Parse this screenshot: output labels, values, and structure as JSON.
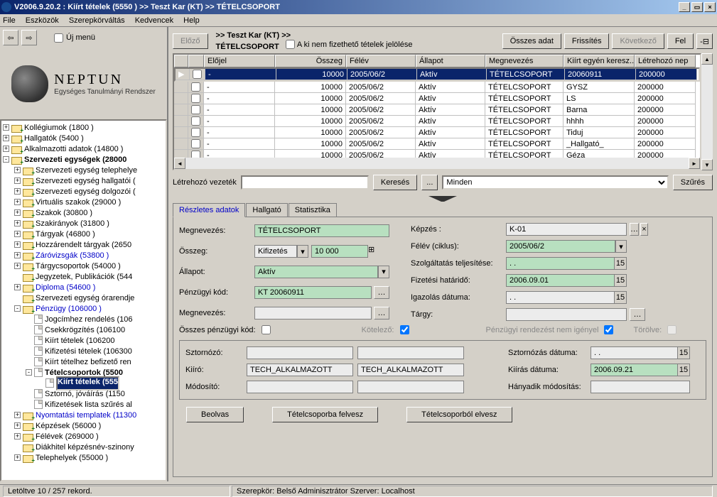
{
  "title": "V2006.9.20.2 : Kiírt tételek (5550  )  >> Teszt Kar (KT) >> TÉTELCSOPORT",
  "menu": [
    "File",
    "Eszközök",
    "Szerepkörváltás",
    "Kedvencek",
    "Help"
  ],
  "nav": {
    "newmenu": "Új menü"
  },
  "brand": {
    "name": "NEPTUN",
    "sub": "Egységes Tanulmányi Rendszer"
  },
  "tree": [
    {
      "i": 0,
      "e": "+",
      "t": "fld",
      "l": "Kollégiumok (1800  )"
    },
    {
      "i": 0,
      "e": "+",
      "t": "fld",
      "l": "Hallgatók (5400  )"
    },
    {
      "i": 0,
      "e": "+",
      "t": "fld",
      "l": "Alkalmazotti adatok (14800  )"
    },
    {
      "i": 0,
      "e": "-",
      "t": "fld",
      "l": "Szervezeti egységek (28000",
      "b": true
    },
    {
      "i": 1,
      "e": "+",
      "t": "fld",
      "l": "Szervezeti egység telephelye"
    },
    {
      "i": 1,
      "e": "+",
      "t": "fld",
      "l": "Szervezeti egység hallgatói ("
    },
    {
      "i": 1,
      "e": "+",
      "t": "fld",
      "l": "Szervezeti egység dolgozói ("
    },
    {
      "i": 1,
      "e": "+",
      "t": "fld",
      "l": "Virtuális szakok (29000  )"
    },
    {
      "i": 1,
      "e": "+",
      "t": "fld",
      "l": "Szakok (30800  )"
    },
    {
      "i": 1,
      "e": "+",
      "t": "fld",
      "l": "Szakirányok (31800  )"
    },
    {
      "i": 1,
      "e": "+",
      "t": "fld",
      "l": "Tárgyak (46800  )"
    },
    {
      "i": 1,
      "e": "+",
      "t": "fld",
      "l": "Hozzárendelt tárgyak (2650"
    },
    {
      "i": 1,
      "e": "+",
      "t": "fld",
      "l": "Záróvizsgák (53800  )",
      "blue": true
    },
    {
      "i": 1,
      "e": "+",
      "t": "fld",
      "l": "Tárgycsoportok (54000  )"
    },
    {
      "i": 1,
      "e": "",
      "t": "fld",
      "l": "Jegyzetek, Publikációk (544"
    },
    {
      "i": 1,
      "e": "+",
      "t": "fld",
      "l": "Diploma (54600  )",
      "blue": true
    },
    {
      "i": 1,
      "e": "",
      "t": "fld",
      "l": "Szervezeti egység órarendje"
    },
    {
      "i": 1,
      "e": "-",
      "t": "fld",
      "l": "Pénzügy (106000  )",
      "blue": true
    },
    {
      "i": 2,
      "e": "",
      "t": "doc",
      "l": "Jogcímhez rendelés (106"
    },
    {
      "i": 2,
      "e": "",
      "t": "doc",
      "l": "Csekkrögzítés (106100"
    },
    {
      "i": 2,
      "e": "",
      "t": "doc",
      "l": "Kiírt tételek (106200"
    },
    {
      "i": 2,
      "e": "",
      "t": "doc",
      "l": "Kifizetési tételek (106300"
    },
    {
      "i": 2,
      "e": "",
      "t": "doc",
      "l": "Kiírt tételhez befizető ren"
    },
    {
      "i": 2,
      "e": "-",
      "t": "doc",
      "l": "Tételcsoportok (5500",
      "b": true
    },
    {
      "i": 3,
      "e": "",
      "t": "doc",
      "l": "Kiírt tételek (555",
      "b": true,
      "sel": true
    },
    {
      "i": 2,
      "e": "",
      "t": "doc",
      "l": "Sztornó, jóváírás (1150"
    },
    {
      "i": 2,
      "e": "",
      "t": "doc",
      "l": "Kifizetések lista szűrés al"
    },
    {
      "i": 1,
      "e": "+",
      "t": "fld",
      "l": "Nyomtatási templatek (11300",
      "blue": true
    },
    {
      "i": 1,
      "e": "+",
      "t": "fld",
      "l": "Képzések (56000  )"
    },
    {
      "i": 1,
      "e": "+",
      "t": "fld",
      "l": "Félévek (269000  )"
    },
    {
      "i": 1,
      "e": "",
      "t": "fld",
      "l": "Diákhitel képzésnév-szinony"
    },
    {
      "i": 1,
      "e": "+",
      "t": "fld",
      "l": "Telephelyek (55000  )"
    }
  ],
  "toolbar": {
    "prev": "Előző",
    "all": "Összes adat",
    "refresh": "Frissítés",
    "next": "Következő",
    "up": "Fel",
    "bc1": ">>  Teszt Kar (KT) >>",
    "bc2": "TÉTELCSOPORT",
    "nopay": "A ki nem fizethető tételek jelölése"
  },
  "grid": {
    "cols": [
      "",
      "",
      "Előjel",
      "Összeg",
      "Félév",
      "Állapot",
      "Megnevezés",
      "Kiírt egyén keresz...",
      "Létrehozó nep"
    ],
    "rows": [
      [
        "-",
        "10000",
        "2005/06/2",
        "Aktív",
        "TÉTELCSOPORT",
        "20060911",
        "200000"
      ],
      [
        "-",
        "10000",
        "2005/06/2",
        "Aktív",
        "TÉTELCSOPORT",
        "GYSZ",
        "200000"
      ],
      [
        "-",
        "10000",
        "2005/06/2",
        "Aktív",
        "TÉTELCSOPORT",
        "LS",
        "200000"
      ],
      [
        "-",
        "10000",
        "2005/06/2",
        "Aktív",
        "TÉTELCSOPORT",
        "Barna",
        "200000"
      ],
      [
        "-",
        "10000",
        "2005/06/2",
        "Aktív",
        "TÉTELCSOPORT",
        "hhhh",
        "200000"
      ],
      [
        "-",
        "10000",
        "2005/06/2",
        "Aktív",
        "TÉTELCSOPORT",
        "Tiduj",
        "200000"
      ],
      [
        "-",
        "10000",
        "2005/06/2",
        "Aktív",
        "TÉTELCSOPORT",
        "_Hallgató_",
        "200000"
      ],
      [
        "-",
        "10000",
        "2005/06/2",
        "Aktív",
        "TÉTELCSOPORT",
        "Géza",
        "200000"
      ]
    ]
  },
  "filter": {
    "lbl": "Létrehozó vezeték",
    "search": "Keresés",
    "dots": "...",
    "all": "Minden",
    "sz": "Szűrés"
  },
  "tabs": [
    "Részletes adatok",
    "Hallgató",
    "Statisztika"
  ],
  "form": {
    "megnevezes_l": "Megnevezés:",
    "megnevezes_v": "TÉTELCSOPORT",
    "osszeg_l": "Összeg:",
    "osszeg_type": "Kifizetés",
    "osszeg_v": "10 000",
    "allapot_l": "Állapot:",
    "allapot_v": "Aktív",
    "pkod_l": "Pénzügyi kód:",
    "pkod_v": "KT 20060911",
    "megnevezes2_l": "Megnevezés:",
    "osszes_l": "Összes pénzügyi kód:",
    "kotelezo_l": "Kötelező:",
    "kepzes_l": "Képzés :",
    "kepzes_v": "K-01",
    "felev_l": "Félév (ciklus):",
    "felev_v": "2005/06/2",
    "szolg_l": "Szolgáltatás teljesítése:",
    "szolg_v": " .   .",
    "hatar_l": "Fizetési határidő:",
    "hatar_v": "2006.09.01",
    "igaz_l": "Igazolás dátuma:",
    "igaz_v": " .   .",
    "targy_l": "Tárgy:",
    "prni_l": "Pénzügyi rendezést nem igényel",
    "torolve_l": "Törölve:",
    "sztornozo_l": "Sztornózó:",
    "kiiro_l": "Kiíró:",
    "kiiro_v": "TECH_ALKALMAZOTT",
    "modosito_l": "Módosító:",
    "szdatum_l": "Sztornózás dátuma:",
    "szdatum_v": " .   .",
    "kidatum_l": "Kiírás dátuma:",
    "kidatum_v": "2006.09.21",
    "hany_l": "Hányadik módosítás:"
  },
  "actions": {
    "read": "Beolvas",
    "add": "Tételcsoporba felvesz",
    "rem": "Tételcsoporból elvesz"
  },
  "status": {
    "rec": "Letöltve 10 / 257 rekord.",
    "role": "Szerepkör: Belső Adminisztrátor   Szerver: Localhost"
  }
}
